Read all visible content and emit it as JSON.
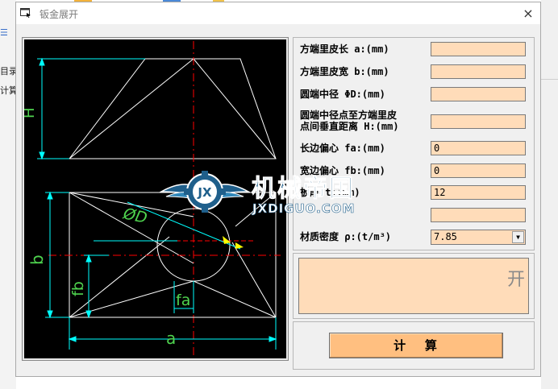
{
  "background": {
    "left_texts": [
      "目录)",
      "计算"
    ],
    "menu_icon": "hamburger-icon"
  },
  "window": {
    "title": "钣金展开",
    "icon": "app-window-icon",
    "close_label": "×"
  },
  "drawing": {
    "label_H": "H",
    "label_phiD": "ØD",
    "label_b": "b",
    "label_fb": "fb",
    "label_fa": "fa",
    "label_a": "a"
  },
  "params": [
    {
      "label": "方端里皮长 a:(mm)",
      "value": ""
    },
    {
      "label": "方端里皮宽 b:(mm)",
      "value": ""
    },
    {
      "label": "圆端中径 ΦD:(mm)",
      "value": ""
    },
    {
      "label_line1": "圆端中径点至方端里皮",
      "label_line2": "点间垂直距离 H:(mm)",
      "value": ""
    },
    {
      "label": "长边偏心 fa:(mm)",
      "value": "0"
    },
    {
      "label": "宽边偏心 fb:(mm)",
      "value": "0"
    },
    {
      "label": "板厚 t:(mm)",
      "value": "12"
    },
    {
      "label": "",
      "value": ""
    },
    {
      "label": "材质密度 ρ:(t/m³)",
      "value": "7.85",
      "type": "select"
    }
  ],
  "output": {
    "text": "开"
  },
  "calc_button": {
    "label": "计   算"
  },
  "watermark": {
    "title": "机械帝国",
    "subtitle": "JXDIGUO.COM",
    "badge_text": "JX"
  },
  "colors": {
    "input_bg": "#ffdcb9",
    "button_bg": "#ffbf80",
    "cad_white": "#ffffff",
    "cad_cyan": "#00ffff",
    "cad_red": "#ff0000",
    "cad_green": "#4fd44f",
    "cad_yellow": "#ffff00"
  }
}
